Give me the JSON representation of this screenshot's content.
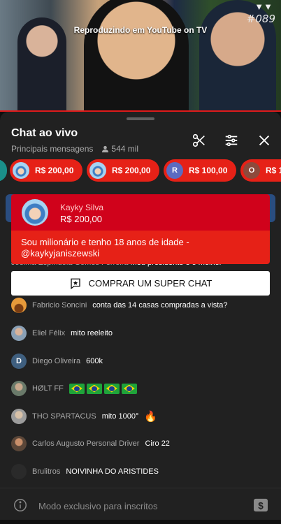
{
  "video": {
    "casting_text": "Reproduzindo em YouTube on TV",
    "badge_text": "#089"
  },
  "chat": {
    "title": "Chat ao vivo",
    "mode": "Principais mensagens",
    "viewers": "544 mil"
  },
  "tickers": [
    {
      "amount": "R$ 200,00",
      "avatar_letter": "",
      "color": "#e62117"
    },
    {
      "amount": "R$ 200,00",
      "avatar_letter": "",
      "color": "#e62117"
    },
    {
      "amount": "R$ 100,00",
      "avatar_letter": "R",
      "color": "#e62117"
    },
    {
      "amount": "R$ 1",
      "avatar_letter": "O",
      "color": "#e62117"
    }
  ],
  "pinned_super_chat": {
    "name": "Kayky Silva",
    "amount": "R$ 200,00",
    "message": "Sou milionário e tenho 18 anos de idade - @kaykyjaniszewski"
  },
  "partial_message": {
    "author": "Joelma Espíndola Gomes Ferreira",
    "text": "Meu presidente é o melhor"
  },
  "buy_button": {
    "label": "COMPRAR UM SUPER CHAT"
  },
  "messages": [
    {
      "author": "Fabricio Soncini",
      "text": "conta das 14 casas compradas a vista?",
      "avatar_letter": "",
      "avatar_color": "#c77a2e"
    },
    {
      "author": "Eliel Félix",
      "text": "mito reeleito",
      "avatar_letter": "",
      "avatar_color": "#8aa0b5"
    },
    {
      "author": "Diego Oliveira",
      "text": "600k",
      "avatar_letter": "D",
      "avatar_color": "#3f5f7f"
    },
    {
      "author": "HØLT FF",
      "text": "",
      "avatar_letter": "",
      "avatar_color": "#7b8f7a"
    },
    {
      "author": "THO SPARTACUS",
      "text": "mito 1000°",
      "avatar_letter": "",
      "avatar_color": "#b0b0b0"
    },
    {
      "author": "Carlos Augusto Personal Driver",
      "text": "Ciro 22",
      "avatar_letter": "",
      "avatar_color": "#8a6a52"
    },
    {
      "author": "Brulitros",
      "text": "NOIVINHA DO ARISTIDES",
      "avatar_letter": "",
      "avatar_color": "#2a2a2a"
    }
  ],
  "footer": {
    "placeholder": "Modo exclusivo para inscritos"
  },
  "colors": {
    "accent_red": "#e62117",
    "pinned_header_red": "#d0021b",
    "panel_bg": "#212121",
    "secondary_text": "#aaaaaa"
  }
}
